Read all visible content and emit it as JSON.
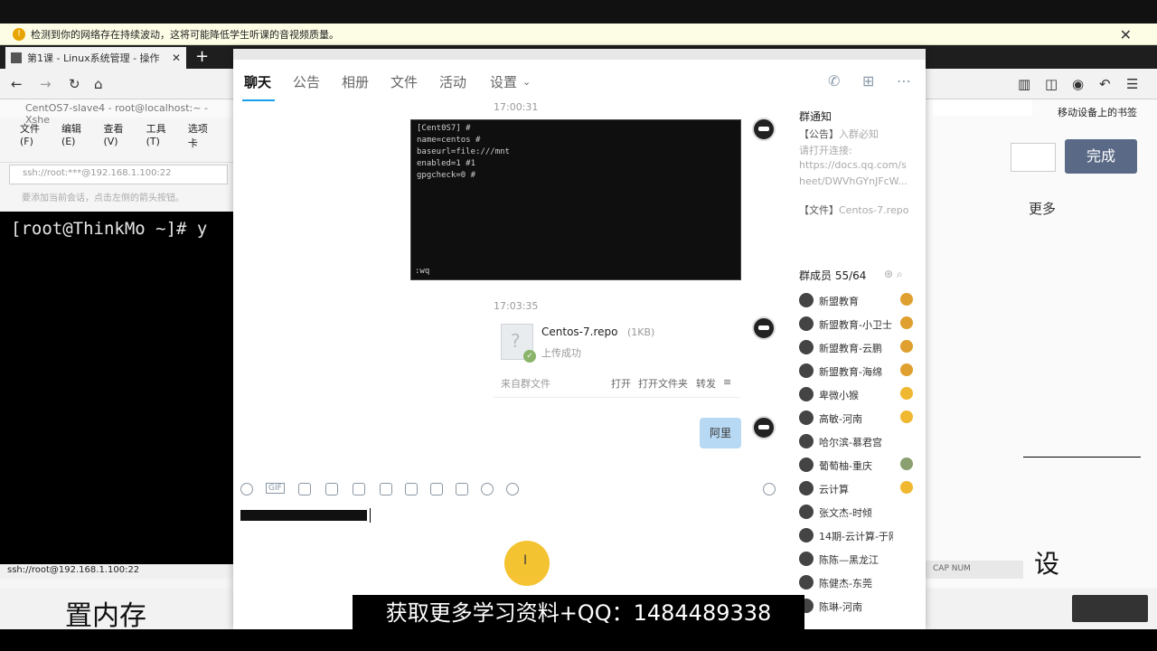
{
  "notice": {
    "text": "检测到你的网络存在持续波动，这将可能降低学生听课的音视频质量。",
    "close": "✕"
  },
  "browser": {
    "tab_title": "第1课 - Linux系统管理 - 操作",
    "tab_close": "✕",
    "new_tab": "+",
    "nav_back": "←",
    "nav_forward": "→",
    "nav_reload": "↻",
    "nav_home": "⌂"
  },
  "xshell": {
    "title": "CentOS7-slave4 - root@localhost:~ - Xshe",
    "menu": [
      "文件(F)",
      "编辑(E)",
      "查看(V)",
      "工具(T)",
      "选项卡"
    ],
    "address": "ssh://root:***@192.168.1.100:22",
    "tabs_hint": "要添加当前会话，点击左侧的箭头按钮。",
    "prompt": "[root@ThinkMo ~]# y",
    "status": "ssh://root@192.168.1.100:22"
  },
  "right_pane": {
    "bookmark_toggle": "移动设备上的书签",
    "done_label": "完成",
    "more_label": "更多",
    "big_char": "设",
    "status_text": "CAP NUM"
  },
  "bottom": {
    "left_text": "置内存"
  },
  "qq": {
    "tabs": [
      "聊天",
      "公告",
      "相册",
      "文件",
      "活动",
      "设置"
    ],
    "messages": {
      "ts1": "17:00:31",
      "screenshot_lines": [
        "[Cent0S7]   #",
        "name=centos   #",
        "baseurl=file:///mnt",
        "enabled=1   #1",
        "gpgcheck=0   #"
      ],
      "screenshot_footer": ":wq",
      "ts2": "17:03:35",
      "file_name": "Centos-7.repo",
      "file_size": "(1KB)",
      "file_status": "上传成功",
      "file_source": "来自群文件",
      "file_actions": [
        "打开",
        "打开文件夹",
        "转发"
      ],
      "bubble_text": "阿里"
    },
    "notice_title": "群通知",
    "notice_lines": [
      {
        "tag": "【公告】",
        "text": "入群必知"
      },
      {
        "tag": "",
        "text": "请打开连接:"
      },
      {
        "tag": "",
        "text": "https://docs.qq.com/s"
      },
      {
        "tag": "",
        "text": "heet/DWVhGYnJFcW..."
      },
      {
        "tag": "【文件】",
        "text": "Centos-7.repo"
      }
    ],
    "members_title": "群成员 55/64",
    "members": [
      {
        "name": "新盟教育",
        "role_color": "#e0a030"
      },
      {
        "name": "新盟教育-小卫士",
        "role_color": "#e0a030"
      },
      {
        "name": "新盟教育-云鹏",
        "role_color": "#e0a030"
      },
      {
        "name": "新盟教育-海绵",
        "role_color": "#e0a030"
      },
      {
        "name": "卑微小猴",
        "role_color": "#f0b830"
      },
      {
        "name": "高敏-河南",
        "role_color": "#f0b830"
      },
      {
        "name": "哈尔滨-慕君宫",
        "role_color": ""
      },
      {
        "name": "葡萄柚-重庆",
        "role_color": "#8aa070"
      },
      {
        "name": "云计算",
        "role_color": "#f0b830"
      },
      {
        "name": "张文杰-时倾",
        "role_color": ""
      },
      {
        "name": "14期-云计算-于刚",
        "role_color": ""
      },
      {
        "name": "陈陈—黑龙江",
        "role_color": ""
      },
      {
        "name": "陈健杰-东莞",
        "role_color": ""
      },
      {
        "name": "陈琳-河南",
        "role_color": ""
      }
    ]
  },
  "caption": "获取更多学习资料+QQ：1484489338"
}
